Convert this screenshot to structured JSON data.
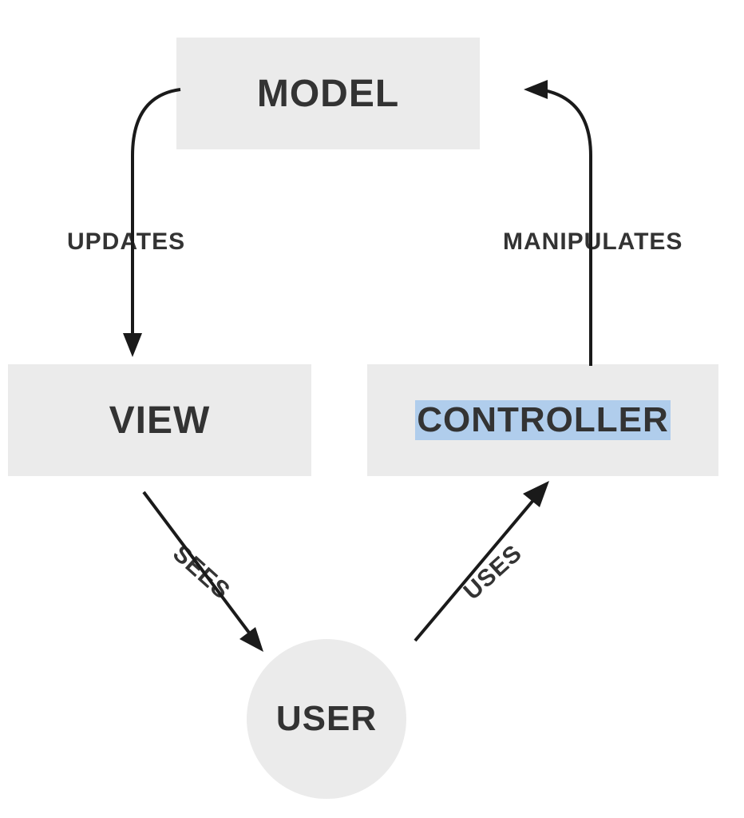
{
  "nodes": {
    "model": "MODEL",
    "view": "VIEW",
    "controller": "CONTROLLER",
    "user": "USER"
  },
  "edges": {
    "updates": "UPDATES",
    "manipulates": "MANIPULATES",
    "sees": "SEES",
    "uses": "USES"
  },
  "colors": {
    "box": "#ebebeb",
    "text": "#333333",
    "highlight": "#b0cdec"
  }
}
